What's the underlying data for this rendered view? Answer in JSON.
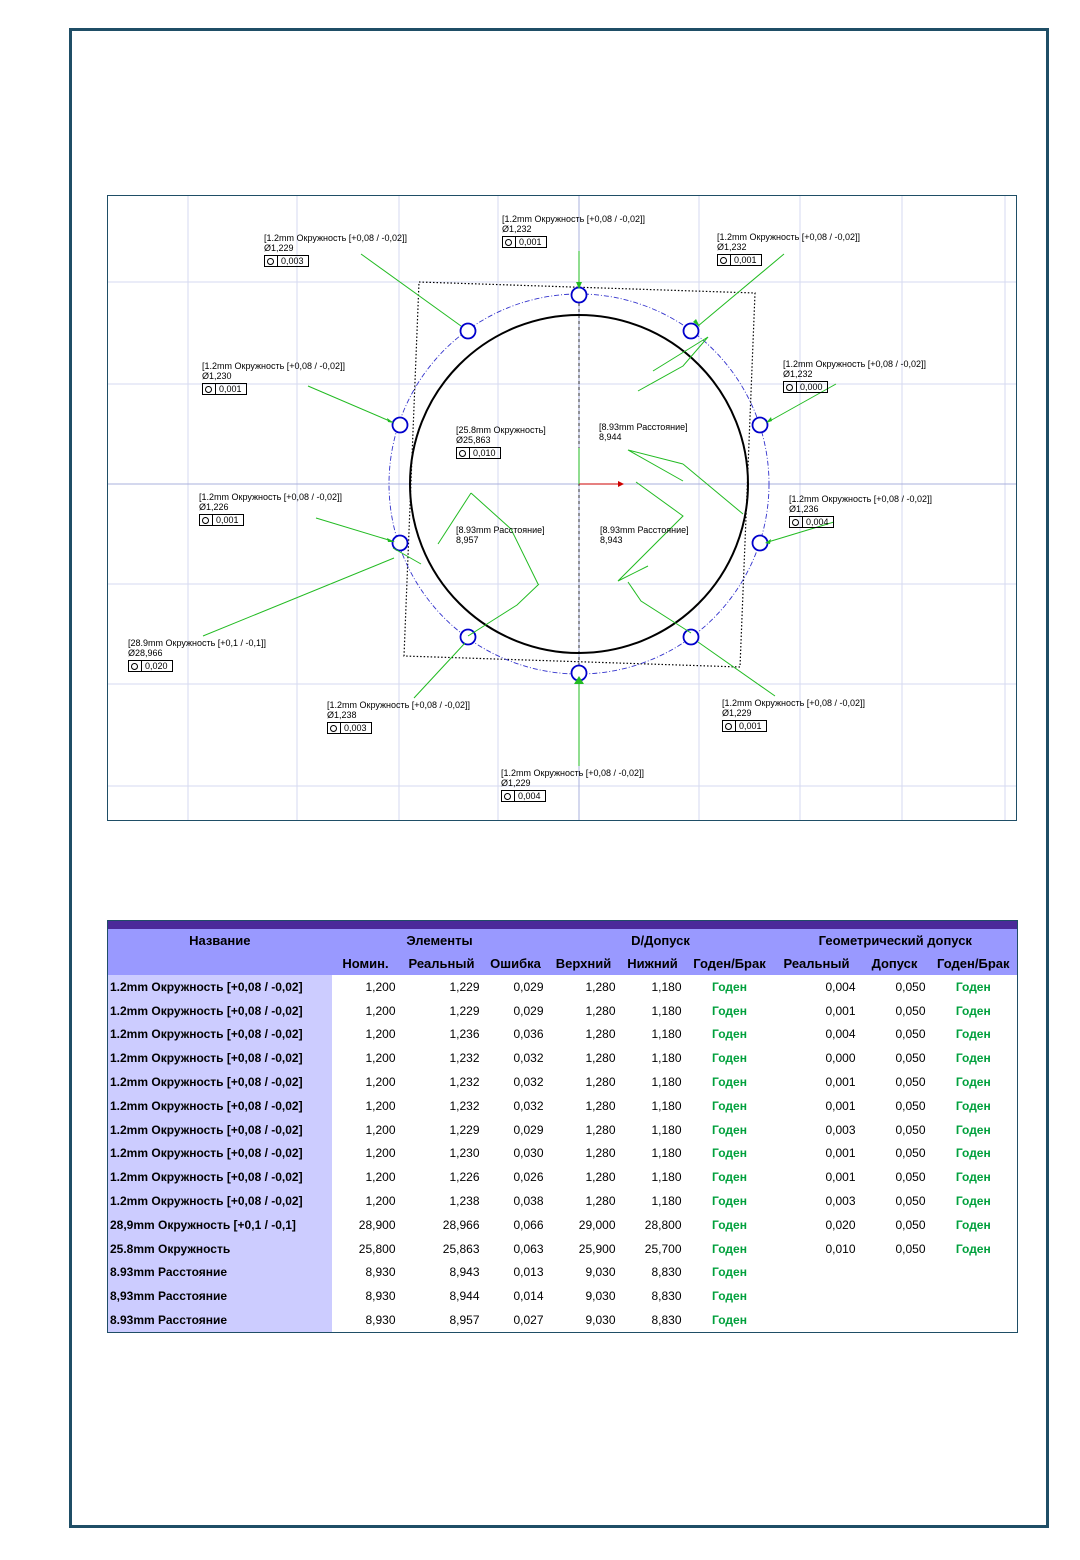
{
  "drawing": {
    "labels": [
      {
        "id": "lbl-top",
        "title": "[1.2mm Окружность [+0,08 / -0,02]]",
        "value": "Ø1,232",
        "tol": "0,001"
      },
      {
        "id": "lbl-topleft",
        "title": "[1.2mm Окружность [+0,08 / -0,02]]",
        "value": "Ø1,229",
        "tol": "0,003"
      },
      {
        "id": "lbl-topright",
        "title": "[1.2mm Окружность [+0,08 / -0,02]]",
        "value": "Ø1,232",
        "tol": "0,001"
      },
      {
        "id": "lbl-left-upper",
        "title": "[1.2mm Окружность [+0,08 / -0,02]]",
        "value": "Ø1,230",
        "tol": "0,001"
      },
      {
        "id": "lbl-right-upper",
        "title": "[1.2mm Окружность [+0,08 / -0,02]]",
        "value": "Ø1,232",
        "tol": "0,000"
      },
      {
        "id": "lbl-center-circle",
        "title": "[25.8mm Окружность]",
        "value": "Ø25,863",
        "tol": "0,010"
      },
      {
        "id": "lbl-dist-upper",
        "title": "[8.93mm Расстояние]",
        "value": "8,944",
        "tol": ""
      },
      {
        "id": "lbl-left-lower",
        "title": "[1.2mm Окружность [+0,08 / -0,02]]",
        "value": "Ø1,226",
        "tol": "0,001"
      },
      {
        "id": "lbl-right-lower",
        "title": "[1.2mm Окружность [+0,08 / -0,02]]",
        "value": "Ø1,236",
        "tol": "0,004"
      },
      {
        "id": "lbl-dist-left",
        "title": "[8.93mm Расстояние]",
        "value": "8,957",
        "tol": ""
      },
      {
        "id": "lbl-dist-right",
        "title": "[8.93mm Расстояние]",
        "value": "8,943",
        "tol": ""
      },
      {
        "id": "lbl-big-circle",
        "title": "[28.9mm Окружность [+0,1 / -0,1]]",
        "value": "Ø28,966",
        "tol": "0,020"
      },
      {
        "id": "lbl-bottomleft",
        "title": "[1.2mm Окружность [+0,08 / -0,02]]",
        "value": "Ø1,238",
        "tol": "0,003"
      },
      {
        "id": "lbl-bottomright",
        "title": "[1.2mm Окружность [+0,08 / -0,02]]",
        "value": "Ø1,229",
        "tol": "0,001"
      },
      {
        "id": "lbl-bottom",
        "title": "[1.2mm Окружность [+0,08 / -0,02]]",
        "value": "Ø1,229",
        "tol": "0,004"
      }
    ]
  },
  "table": {
    "group_headers": {
      "name": "Название",
      "elements": "Элементы",
      "d_tol": "D/Допуск",
      "geom": "Геометрический допуск"
    },
    "sub_headers": [
      "Номин.",
      "Реальный",
      "Ошибка",
      "Верхний",
      "Нижний",
      "Годен/Брак",
      "Реальный",
      "Допуск",
      "Годен/Брак"
    ],
    "rows": [
      {
        "name": "1.2mm Окружность [+0,08 / -0,02]",
        "nom": "1,200",
        "real": "1,229",
        "err": "0,029",
        "up": "1,280",
        "low": "1,180",
        "status": "Годен",
        "g_real": "0,004",
        "g_tol": "0,050",
        "g_status": "Годен"
      },
      {
        "name": "1.2mm Окружность [+0,08 / -0,02]",
        "nom": "1,200",
        "real": "1,229",
        "err": "0,029",
        "up": "1,280",
        "low": "1,180",
        "status": "Годен",
        "g_real": "0,001",
        "g_tol": "0,050",
        "g_status": "Годен"
      },
      {
        "name": "1.2mm Окружность [+0,08 / -0,02]",
        "nom": "1,200",
        "real": "1,236",
        "err": "0,036",
        "up": "1,280",
        "low": "1,180",
        "status": "Годен",
        "g_real": "0,004",
        "g_tol": "0,050",
        "g_status": "Годен"
      },
      {
        "name": "1.2mm Окружность [+0,08 / -0,02]",
        "nom": "1,200",
        "real": "1,232",
        "err": "0,032",
        "up": "1,280",
        "low": "1,180",
        "status": "Годен",
        "g_real": "0,000",
        "g_tol": "0,050",
        "g_status": "Годен"
      },
      {
        "name": "1.2mm Окружность [+0,08 / -0,02]",
        "nom": "1,200",
        "real": "1,232",
        "err": "0,032",
        "up": "1,280",
        "low": "1,180",
        "status": "Годен",
        "g_real": "0,001",
        "g_tol": "0,050",
        "g_status": "Годен"
      },
      {
        "name": "1.2mm Окружность [+0,08 / -0,02]",
        "nom": "1,200",
        "real": "1,232",
        "err": "0,032",
        "up": "1,280",
        "low": "1,180",
        "status": "Годен",
        "g_real": "0,001",
        "g_tol": "0,050",
        "g_status": "Годен"
      },
      {
        "name": "1.2mm Окружность [+0,08 / -0,02]",
        "nom": "1,200",
        "real": "1,229",
        "err": "0,029",
        "up": "1,280",
        "low": "1,180",
        "status": "Годен",
        "g_real": "0,003",
        "g_tol": "0,050",
        "g_status": "Годен"
      },
      {
        "name": "1.2mm Окружность [+0,08 / -0,02]",
        "nom": "1,200",
        "real": "1,230",
        "err": "0,030",
        "up": "1,280",
        "low": "1,180",
        "status": "Годен",
        "g_real": "0,001",
        "g_tol": "0,050",
        "g_status": "Годен"
      },
      {
        "name": "1.2mm Окружность [+0,08 / -0,02]",
        "nom": "1,200",
        "real": "1,226",
        "err": "0,026",
        "up": "1,280",
        "low": "1,180",
        "status": "Годен",
        "g_real": "0,001",
        "g_tol": "0,050",
        "g_status": "Годен"
      },
      {
        "name": "1.2mm Окружность [+0,08 / -0,02]",
        "nom": "1,200",
        "real": "1,238",
        "err": "0,038",
        "up": "1,280",
        "low": "1,180",
        "status": "Годен",
        "g_real": "0,003",
        "g_tol": "0,050",
        "g_status": "Годен"
      },
      {
        "name": "28,9mm Окружность [+0,1 / -0,1]",
        "nom": "28,900",
        "real": "28,966",
        "err": "0,066",
        "up": "29,000",
        "low": "28,800",
        "status": "Годен",
        "g_real": "0,020",
        "g_tol": "0,050",
        "g_status": "Годен"
      },
      {
        "name": "25.8mm Окружность",
        "nom": "25,800",
        "real": "25,863",
        "err": "0,063",
        "up": "25,900",
        "low": "25,700",
        "status": "Годен",
        "g_real": "0,010",
        "g_tol": "0,050",
        "g_status": "Годен"
      },
      {
        "name": "8.93mm Расстояние",
        "nom": "8,930",
        "real": "8,943",
        "err": "0,013",
        "up": "9,030",
        "low": "8,830",
        "status": "Годен",
        "g_real": "",
        "g_tol": "",
        "g_status": ""
      },
      {
        "name": "8,93mm Расстояние",
        "nom": "8,930",
        "real": "8,944",
        "err": "0,014",
        "up": "9,030",
        "low": "8,830",
        "status": "Годен",
        "g_real": "",
        "g_tol": "",
        "g_status": ""
      },
      {
        "name": "8.93mm Расстояние",
        "nom": "8,930",
        "real": "8,957",
        "err": "0,027",
        "up": "9,030",
        "low": "8,830",
        "status": "Годен",
        "g_real": "",
        "g_tol": "",
        "g_status": ""
      }
    ]
  },
  "colors": {
    "frame": "#1f4e66",
    "header_band": "#4b2a9a",
    "header_bg": "#9999ff",
    "name_bg": "#ccccff",
    "ok_text": "#00a03c",
    "leader": "#22bb22",
    "hole": "#0000cc",
    "pcd": "#3333cc"
  }
}
